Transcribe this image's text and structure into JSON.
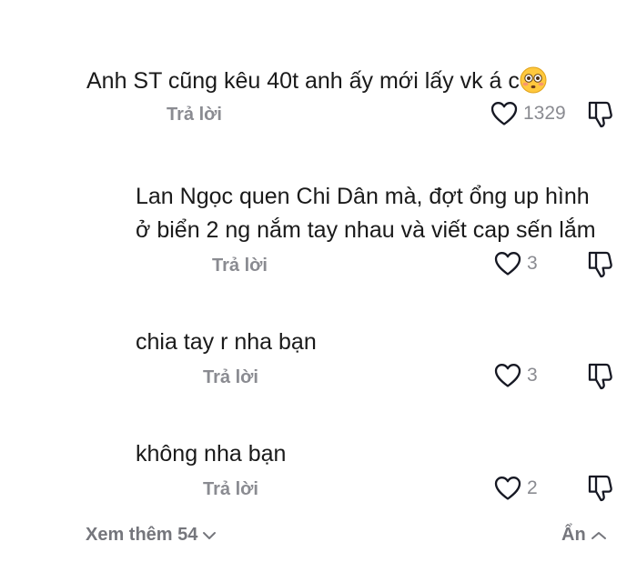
{
  "comments": [
    {
      "text": "Anh ST cũng kêu 40t anh ấy mới lấy vk á c",
      "emoji": "flushed-face-emoji",
      "reply_label": "Trả lời",
      "likes": "1329"
    },
    {
      "text_line1": "Lan Ngọc quen Chi Dân mà, đợt ổng up hình",
      "text_line2": "ở biển 2 ng nắm tay nhau và viết cap sến lắm",
      "reply_label": "Trả lời",
      "likes": "3"
    },
    {
      "text": "chia tay r nha bạn",
      "reply_label": "Trả lời",
      "likes": "3"
    },
    {
      "text": "không nha bạn",
      "reply_label": "Trả lời",
      "likes": "2"
    }
  ],
  "footer": {
    "view_more_label": "Xem thêm 54",
    "hide_label": "Ẩn"
  },
  "icons": {
    "like": "heart-outline-icon",
    "dislike": "thumbs-down-outline-icon",
    "expand": "chevron-down-icon",
    "collapse": "chevron-up-icon"
  },
  "colors": {
    "text": "#1a1a1a",
    "muted": "#8a8b91",
    "icon": "#161823"
  }
}
